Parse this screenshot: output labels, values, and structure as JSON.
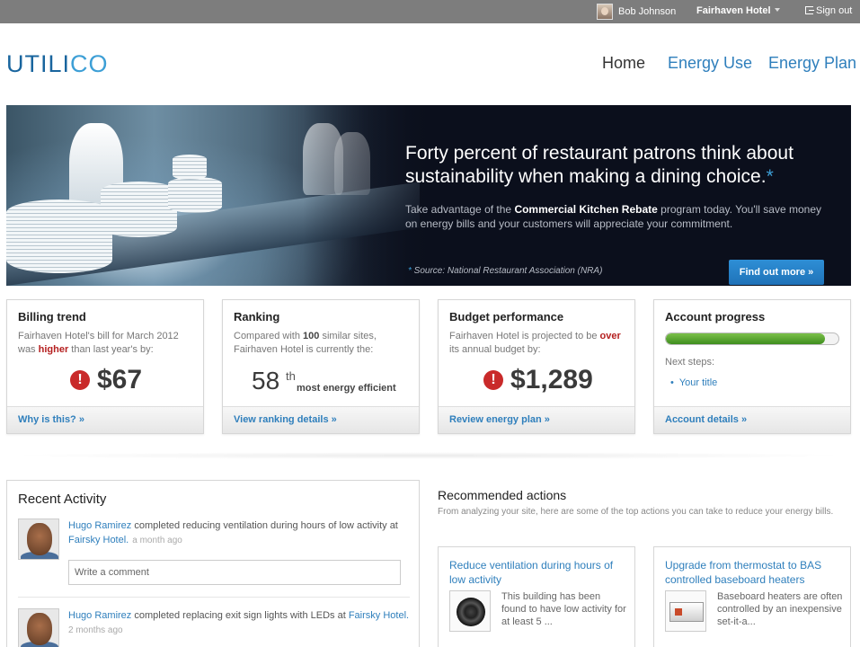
{
  "topbar": {
    "user_name": "Bob Johnson",
    "site_name": "Fairhaven Hotel",
    "signout_label": "Sign out"
  },
  "header": {
    "logo_main": "UTILI",
    "logo_accent": "CO",
    "nav": {
      "home": "Home",
      "energy_use": "Energy Use",
      "energy_plan": "Energy Plan"
    }
  },
  "hero": {
    "title": "Forty percent of restaurant patrons think about sustainability when making a dining choice.",
    "title_mark": "*",
    "text_before": "Take advantage of the ",
    "text_bold": "Commercial Kitchen Rebate",
    "text_after": " program today. You'll save money on energy bills and your customers will appreciate your commitment.",
    "source_mark": "*",
    "source": " Source: National Restaurant Association (NRA)",
    "button_label": "Find out more »"
  },
  "cards": {
    "billing": {
      "title": "Billing trend",
      "desc_1": "Fairhaven Hotel's bill for March 2012",
      "desc_2a": "was ",
      "desc_2b": "higher",
      "desc_2c": " than last year's by:",
      "value": "$67",
      "alert_icon": "!",
      "footer": "Why is this? »"
    },
    "ranking": {
      "title": "Ranking",
      "desc_1a": "Compared with ",
      "desc_1b": "100",
      "desc_1c": " similar sites,",
      "desc_2": "Fairhaven Hotel is currently the:",
      "rank": "58",
      "rank_suffix": "th",
      "rank_label": "most energy efficient",
      "footer": "View ranking details »"
    },
    "budget": {
      "title": "Budget performance",
      "desc_1a": "Fairhaven Hotel is projected to be ",
      "desc_1b": "over",
      "desc_2": "its annual budget by:",
      "value": "$1,289",
      "alert_icon": "!",
      "footer": "Review energy plan »"
    },
    "account": {
      "title": "Account progress",
      "progress_fraction": 0.92,
      "next_label": "Next steps:",
      "next_item": "Your title",
      "footer": "Account details »"
    }
  },
  "activity": {
    "title": "Recent Activity",
    "items": [
      {
        "name": "Hugo Ramirez",
        "action": " completed reducing ventilation during hours of low activity at ",
        "place": "Fairsky Hotel.",
        "time": "a month ago",
        "comment_placeholder": "Write a comment"
      },
      {
        "name": "Hugo Ramirez",
        "action": " completed replacing exit sign lights with LEDs at ",
        "place": "Fairsky Hotel.",
        "time": "2 months ago"
      }
    ]
  },
  "recommended": {
    "title": "Recommended actions",
    "desc": "From analyzing your site, here are some of the top actions you can take to reduce your energy bills.",
    "items": [
      {
        "title": "Reduce ventilation during hours of low activity",
        "text": "This building has been found to have low activity for at least 5 ...",
        "icon": "fan-icon"
      },
      {
        "title": "Upgrade from thermostat to BAS controlled baseboard heaters",
        "text": "Baseboard heaters are often controlled by an inexpensive set-it-a...",
        "icon": "heater-icon"
      }
    ]
  },
  "colors": {
    "brand_dark": "#19659e",
    "brand_light": "#3d9fd6",
    "link": "#2f7fbc",
    "alert": "#c92a2a",
    "progress": "#5aa832"
  }
}
